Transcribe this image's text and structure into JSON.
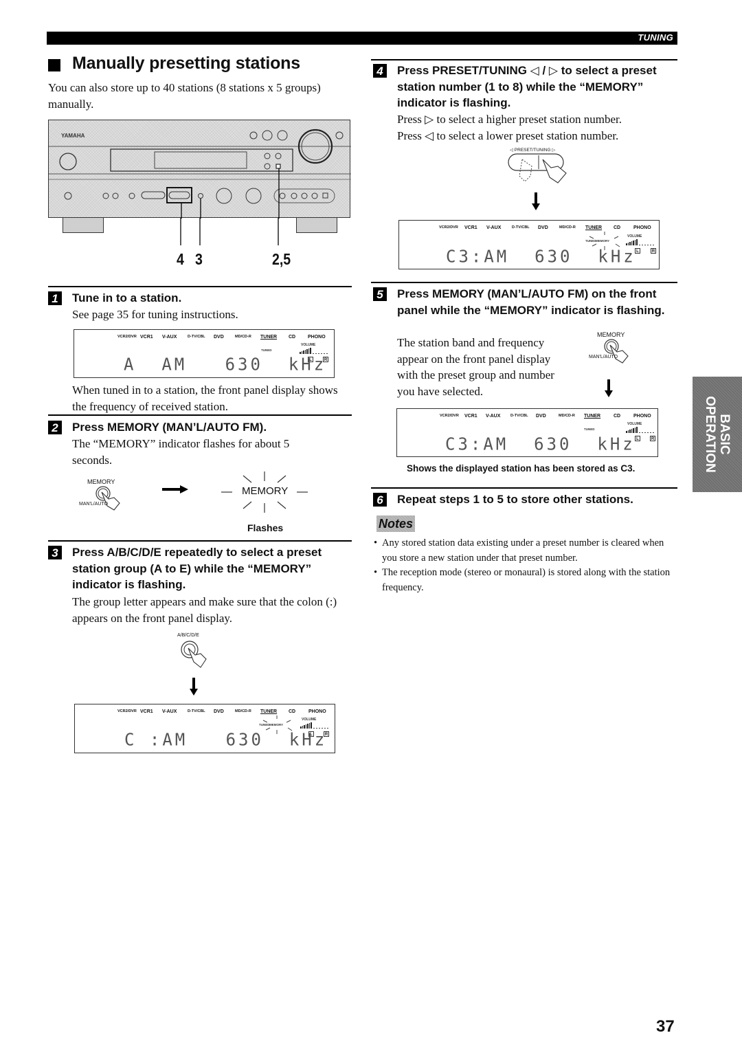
{
  "header": {
    "section_tag": "TUNING"
  },
  "page": {
    "title": "Manually presetting stations",
    "intro": "You can also store up to 40 stations (8 stations x 5 groups) manually.",
    "number": "37"
  },
  "side_tab": {
    "line1": "BASIC",
    "line2": "OPERATION"
  },
  "receiver_figure": {
    "brand": "YAMAHA",
    "callouts": [
      "4",
      "3",
      "2,5"
    ]
  },
  "display_inputs": [
    "VCR2/DVR",
    "VCR1",
    "V-AUX",
    "D-TV/CBL",
    "DVD",
    "MD/CD-R",
    "TUNER",
    "CD",
    "PHONO"
  ],
  "display_labels": {
    "volume": "VOLUME",
    "tuned": "TUNED",
    "memory": "MEMORY",
    "left": "L",
    "right": "R"
  },
  "steps": [
    {
      "number": "1",
      "heading": "Tune in to a station.",
      "body": "See page 35 for tuning instructions.",
      "display": {
        "main_text": "A  AM   630  kHz",
        "memory_indicator": false
      },
      "after": "When tuned in to a station, the front panel display shows the frequency of received station."
    },
    {
      "number": "2",
      "heading": "Press MEMORY (MAN’L/AUTO FM).",
      "body": "The “MEMORY” indicator flashes for about 5 seconds.",
      "button_top_label": "MEMORY",
      "button_bottom_label": "MAN'L/AUTO",
      "indicator_label": "MEMORY",
      "caption": "Flashes"
    },
    {
      "number": "3",
      "heading": "Press A/B/C/D/E repeatedly to select a preset station group (A to E) while the “MEMORY” indicator is flashing.",
      "body": "The group letter appears and make sure that the colon (:) appears on the front panel display.",
      "button_label": "A/B/C/D/E",
      "display": {
        "main_text": "C :AM   630  kHz",
        "memory_indicator": true
      }
    },
    {
      "number": "4",
      "heading": "Press PRESET/TUNING ◁ / ▷ to select a preset station number (1 to 8) while the “MEMORY” indicator is flashing.",
      "body_lines": [
        "Press ▷ to select a higher preset station number.",
        "Press ◁ to select a lower preset station number."
      ],
      "button_label": "◁ PRESET/TUNING ▷",
      "display": {
        "main_text": "C3:AM  630  kHz",
        "memory_indicator": true
      }
    },
    {
      "number": "5",
      "heading": "Press MEMORY (MAN’L/AUTO FM) on the front panel while the “MEMORY” indicator is flashing.",
      "body": "The station band and frequency appear on the front panel display with the preset group and number you have selected.",
      "button_top_label": "MEMORY",
      "button_bottom_label": "MAN'L/AUTO",
      "display": {
        "main_text": "C3:AM  630  kHz",
        "memory_indicator": false
      },
      "caption": "Shows the displayed station has been stored as C3."
    },
    {
      "number": "6",
      "heading": "Repeat steps 1 to 5 to store other stations."
    }
  ],
  "notes": {
    "title": "Notes",
    "items": [
      "Any stored station data existing under a preset number is cleared when you store a new station under that preset number.",
      "The reception mode (stereo or monaural) is stored along with the station frequency."
    ]
  }
}
